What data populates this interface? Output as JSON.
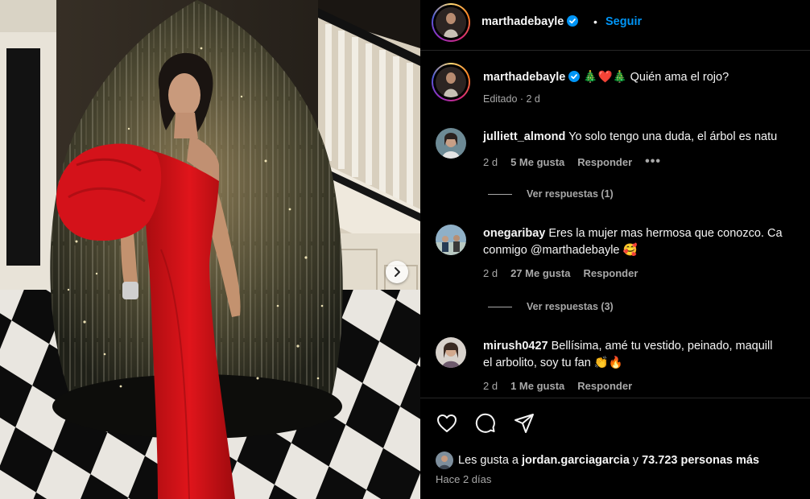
{
  "post": {
    "author": "marthadebayle",
    "follow_label": "Seguir",
    "separator": "•",
    "caption": "🎄❤️🎄 Quién ama el rojo?",
    "caption_meta": "Editado · 2 d"
  },
  "comments": [
    {
      "username": "julliett_almond",
      "line1": "Yo solo tengo una duda, el árbol es natu",
      "line2": "",
      "time": "2 d",
      "likes": "5 Me gusta",
      "reply_label": "Responder",
      "more": "•••",
      "view_replies": "Ver respuestas (1)"
    },
    {
      "username": "onegaribay",
      "line1": "Eres la mujer mas hermosa que conozco. Ca",
      "line2": "conmigo @marthadebayle 🥰",
      "time": "2 d",
      "likes": "27 Me gusta",
      "reply_label": "Responder",
      "view_replies": "Ver respuestas (3)"
    },
    {
      "username": "mirush0427",
      "line1": "Bellísima, amé tu vestido, peinado, maquill",
      "line2": "el arbolito, soy tu fan 👏🔥",
      "time": "2 d",
      "likes": "1 Me gusta",
      "reply_label": "Responder"
    }
  ],
  "footer": {
    "likes_prefix": "Les gusta a ",
    "liked_by": "jordan.garciagarcia",
    "likes_mid": " y ",
    "likes_count": "73.723 personas más",
    "time_ago": "Hace 2 días"
  },
  "icons": {
    "like": "heart-icon",
    "comment": "comment-icon",
    "share": "share-icon",
    "next": "chevron-right-icon",
    "verified": "verified-badge-icon"
  },
  "colors": {
    "background": "#000000",
    "link_blue": "#0095f6",
    "verified_blue": "#0095f6",
    "muted": "#a8a8a8",
    "dress_red": "#d40f14"
  }
}
